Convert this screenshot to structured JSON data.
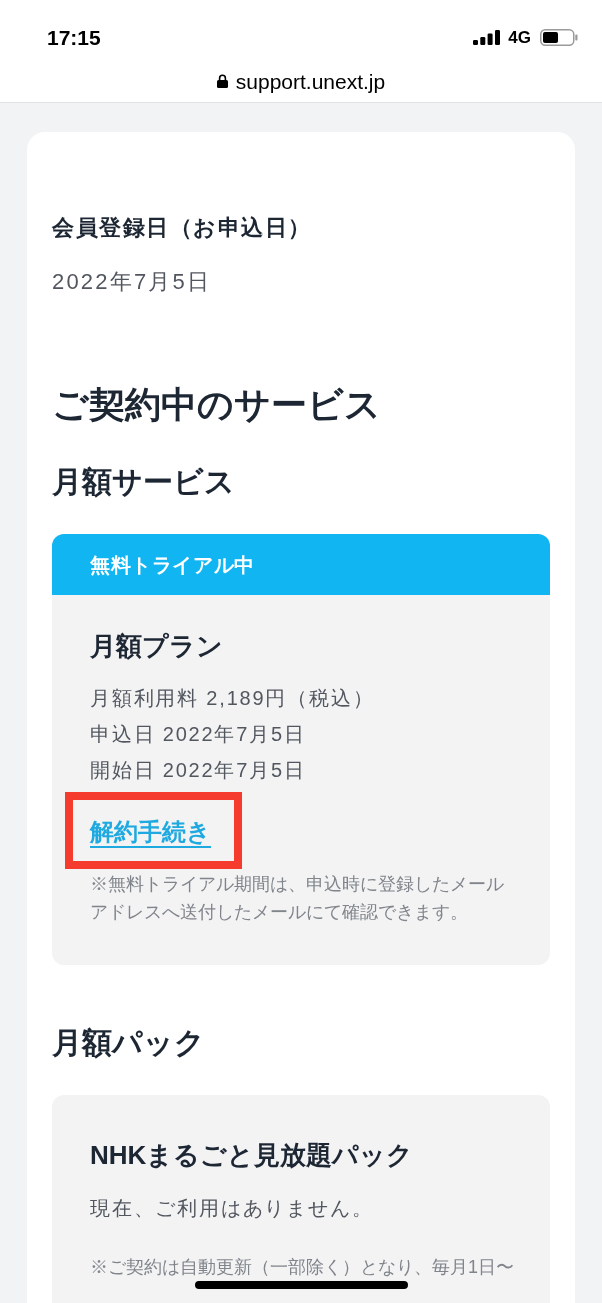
{
  "status_bar": {
    "time": "17:15",
    "network": "4G"
  },
  "address_bar": {
    "url": "support.unext.jp"
  },
  "registration": {
    "label": "会員登録日（お申込日）",
    "value": "2022年7月5日"
  },
  "contracts_heading": "ご契約中のサービス",
  "sections": [
    {
      "heading": "月額サービス",
      "cards": [
        {
          "banner": "無料トライアル中",
          "title": "月額プラン",
          "details": [
            "月額利用料 2,189円（税込）",
            "申込日 2022年7月5日",
            "開始日 2022年7月5日"
          ],
          "link": {
            "label": "解約手続き",
            "highlighted": true
          },
          "note": "※無料トライアル期間は、申込時に登録したメールアドレスへ送付したメールにて確認できます。"
        }
      ]
    },
    {
      "heading": "月額パック",
      "cards": [
        {
          "title": "NHKまるごと見放題パック",
          "details": [
            "現在、ご利用はありません。"
          ],
          "note": "※ご契約は自動更新（一部除く）となり、毎月1日〜"
        }
      ]
    }
  ]
}
